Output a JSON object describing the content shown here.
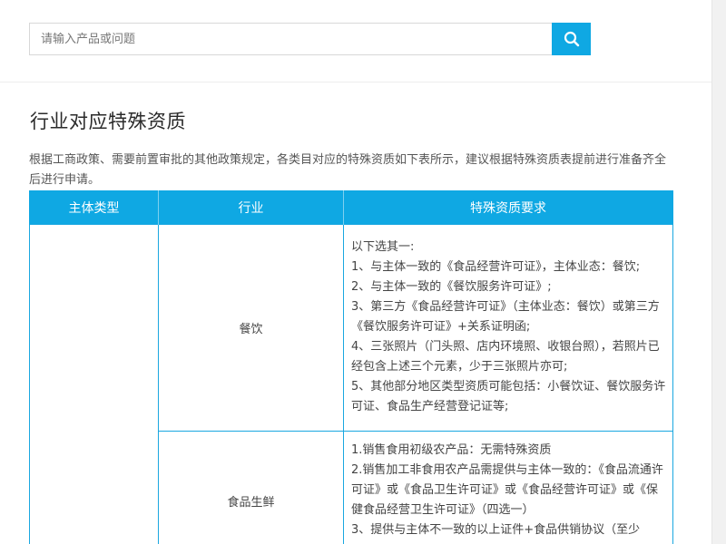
{
  "search": {
    "placeholder": "请输入产品或问题",
    "value": "",
    "button_icon": "search-icon",
    "accent": "#0fa8e3"
  },
  "section": {
    "title": "行业对应特殊资质",
    "description": "根据工商政策、需要前置审批的其他政策规定，各类目对应的特殊资质如下表所示，建议根据特殊资质表提前进行准备齐全后进行申请。"
  },
  "table": {
    "header_color": "#0fa8e3",
    "headers": [
      "主体类型",
      "行业",
      "特殊资质要求"
    ],
    "subject_type": "",
    "rows": [
      {
        "industry": "餐饮",
        "requirements": [
          "以下选其一:",
          "1、与主体一致的《食品经营许可证》，主体业态：餐饮;",
          "2、与主体一致的《餐饮服务许可证》;",
          "3、第三方《食品经营许可证》（主体业态：餐饮）或第三方《餐饮服务许可证》+关系证明函;",
          "4、三张照片（门头照、店内环境照、收银台照），若照片已经包含上述三个元素，少于三张照片亦可;",
          "5、其他部分地区类型资质可能包括：小餐饮证、餐饮服务许可证、食品生产经营登记证等;"
        ]
      },
      {
        "industry": "食品生鲜",
        "requirements": [
          "1.销售食用初级农产品：无需特殊资质",
          "2.销售加工非食用农产品需提供与主体一致的：《食品流通许可证》或《食品卫生许可证》或《食品经营许可证》或《保健食品经营卫生许可证》（四选一）",
          "3、提供与主体不一致的以上证件+食品供销协议（至少"
        ]
      }
    ]
  }
}
